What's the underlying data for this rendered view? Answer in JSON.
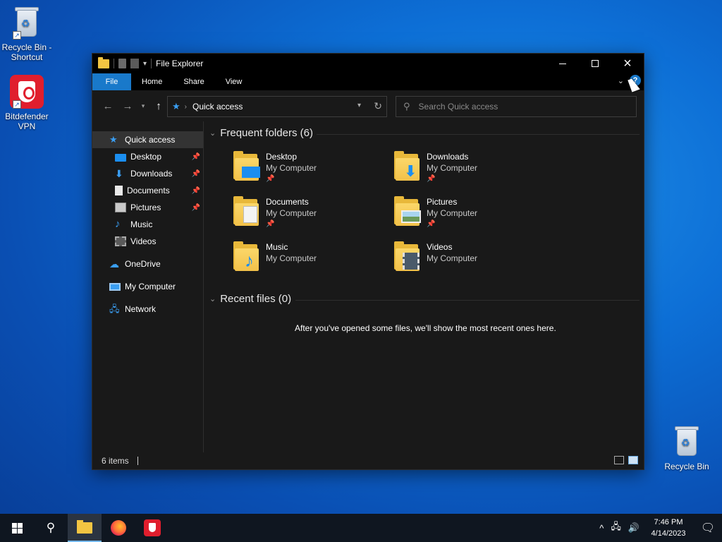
{
  "desktop": {
    "icons": [
      {
        "label": "Recycle Bin - Shortcut"
      },
      {
        "label": "Bitdefender VPN"
      },
      {
        "label": "Recycle Bin"
      }
    ]
  },
  "window": {
    "title": "File Explorer",
    "controls": {
      "minimize": "minimize",
      "maximize": "maximize",
      "close": "×"
    },
    "ribbon": {
      "tabs": [
        "File",
        "Home",
        "Share",
        "View"
      ],
      "help_label": "?"
    },
    "address": {
      "path": "Quick access",
      "search_placeholder": "Search Quick access"
    },
    "nav": {
      "items": [
        {
          "label": "Quick access",
          "icon": "star-icon",
          "pinned": false
        },
        {
          "label": "Desktop",
          "icon": "desktop-icon",
          "pinned": true
        },
        {
          "label": "Downloads",
          "icon": "download-icon",
          "pinned": true
        },
        {
          "label": "Documents",
          "icon": "document-icon",
          "pinned": true
        },
        {
          "label": "Pictures",
          "icon": "pictures-icon",
          "pinned": true
        },
        {
          "label": "Music",
          "icon": "music-icon",
          "pinned": false
        },
        {
          "label": "Videos",
          "icon": "videos-icon",
          "pinned": false
        },
        {
          "label": "OneDrive",
          "icon": "cloud-icon",
          "pinned": false
        },
        {
          "label": "My Computer",
          "icon": "computer-icon",
          "pinned": false
        },
        {
          "label": "Network",
          "icon": "network-icon",
          "pinned": false
        }
      ]
    },
    "content": {
      "frequent_header": "Frequent folders (6)",
      "folders": [
        {
          "name": "Desktop",
          "location": "My Computer",
          "pinned": true
        },
        {
          "name": "Downloads",
          "location": "My Computer",
          "pinned": true
        },
        {
          "name": "Documents",
          "location": "My Computer",
          "pinned": true
        },
        {
          "name": "Pictures",
          "location": "My Computer",
          "pinned": true
        },
        {
          "name": "Music",
          "location": "My Computer",
          "pinned": false
        },
        {
          "name": "Videos",
          "location": "My Computer",
          "pinned": false
        }
      ],
      "recent_header": "Recent files (0)",
      "recent_empty": "After you've opened some files, we'll show the most recent ones here."
    },
    "status": {
      "count": "6 items"
    }
  },
  "taskbar": {
    "time": "7:46 PM",
    "date": "4/14/2023"
  },
  "colors": {
    "accent": "#1979ca",
    "window_bg": "#191919",
    "titlebar_bg": "#000000",
    "folder_yellow": "#f2c14a",
    "taskbar_bg": "#0f1620"
  }
}
